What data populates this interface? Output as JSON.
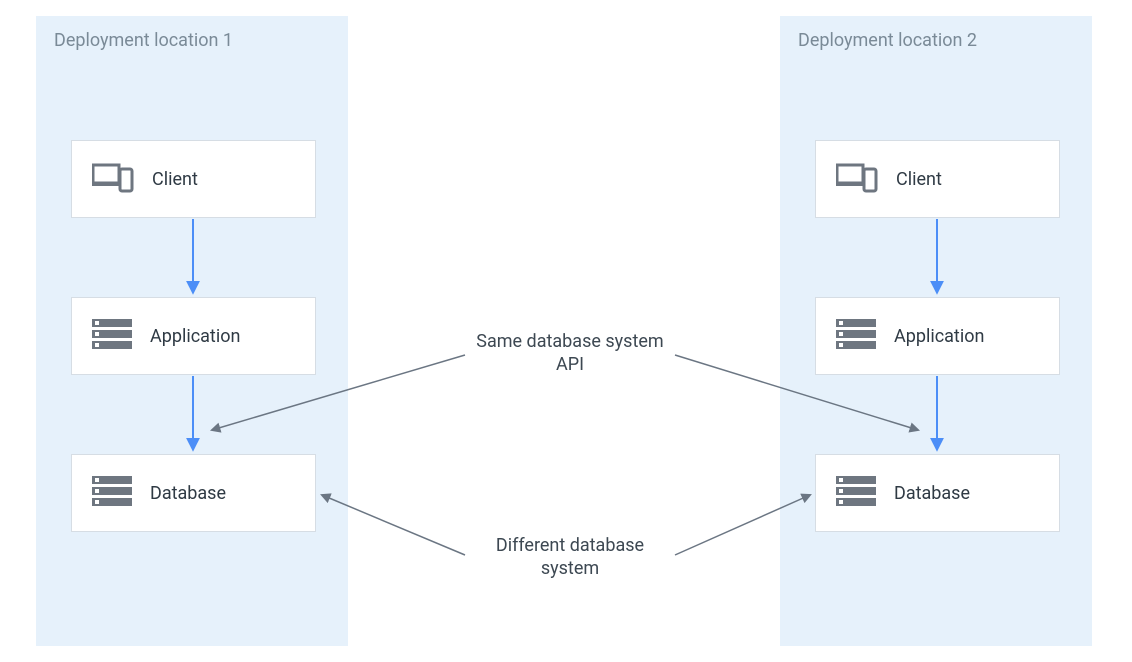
{
  "regions": {
    "left": {
      "title": "Deployment location 1"
    },
    "right": {
      "title": "Deployment location 2"
    }
  },
  "nodes": {
    "client": {
      "label": "Client"
    },
    "application": {
      "label": "Application"
    },
    "database": {
      "label": "Database"
    }
  },
  "annotations": {
    "same_api": "Same database system API",
    "diff_db": "Different database system"
  },
  "colors": {
    "region_bg": "#e6f1fb",
    "node_border": "#d6dde4",
    "arrow_blue": "#4c8ef7",
    "arrow_gray": "#6b7683"
  }
}
